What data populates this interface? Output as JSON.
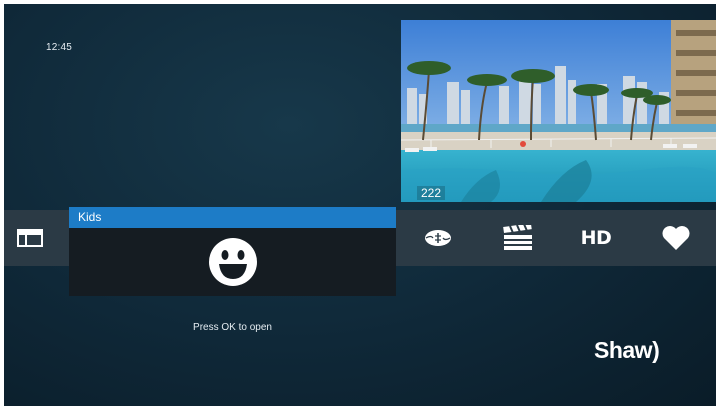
{
  "clock": {
    "time": "12:45"
  },
  "preview": {
    "channel_number": "222"
  },
  "menu": {
    "items": [
      {
        "icon": "guide-icon"
      },
      {
        "popup_title": "Kids",
        "icon": "smiley-icon"
      },
      {
        "icon": "football-icon"
      },
      {
        "icon": "clapperboard-icon"
      },
      {
        "label": "HD",
        "icon": "hd-icon"
      },
      {
        "icon": "heart-icon"
      }
    ],
    "hint": "Press OK to open",
    "accent_color": "#1d7cc7"
  },
  "brand": {
    "logo_text": "Shaw)"
  }
}
